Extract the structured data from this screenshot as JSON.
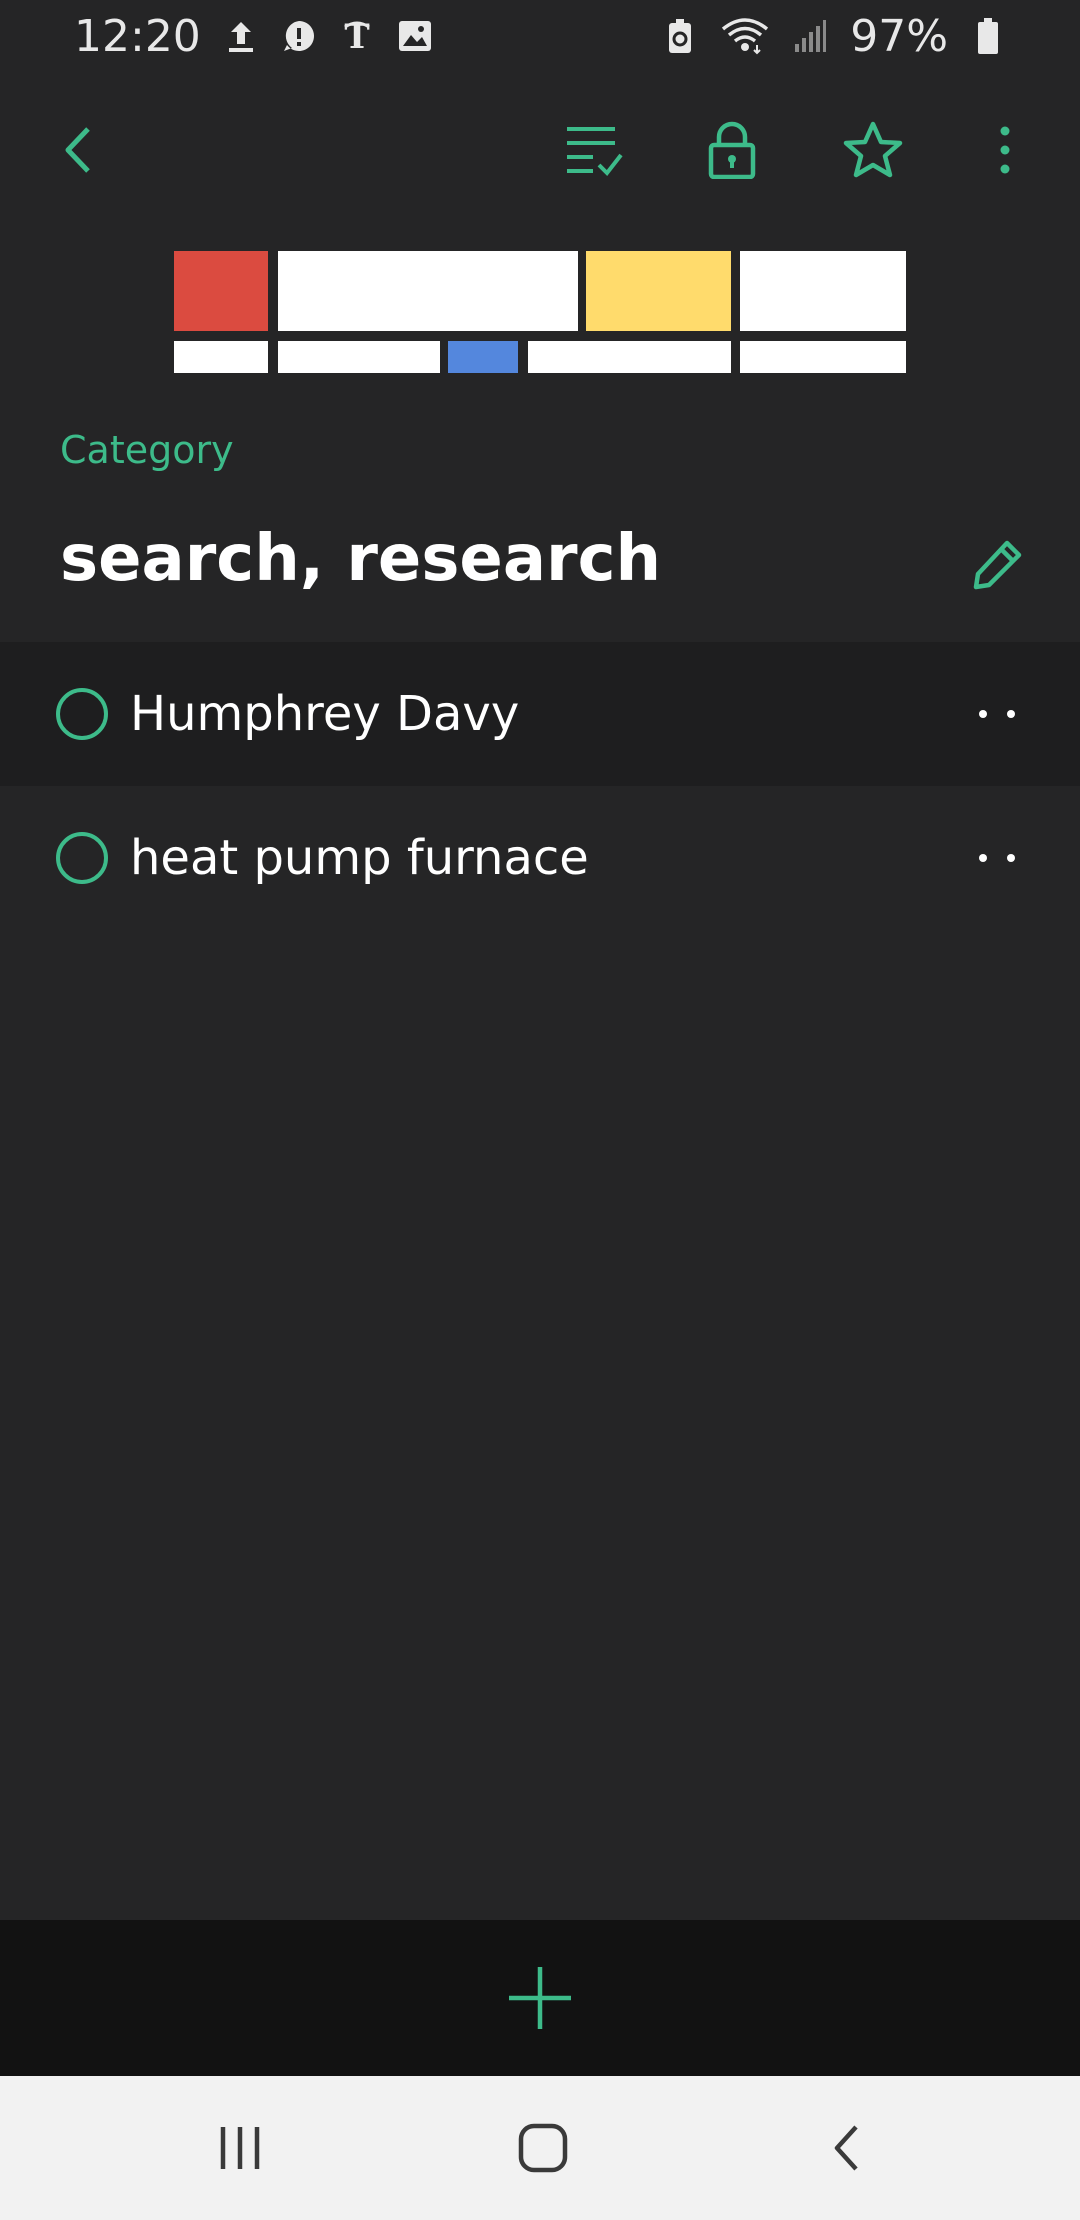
{
  "status_bar": {
    "time": "12:20",
    "left_icons": [
      "upload-icon",
      "alert-icon",
      "nyt-icon",
      "image-icon"
    ],
    "right_icons": [
      "battery-saver-icon",
      "wifi-icon",
      "signal-icon",
      "battery-icon"
    ],
    "battery_percent": "97%"
  },
  "toolbar": {
    "icons": [
      "back-icon",
      "checklist-icon",
      "lock-icon",
      "star-icon",
      "more-vert-icon"
    ]
  },
  "banner": {
    "colors": {
      "red": "#db4b40",
      "white": "#ffffff",
      "yellow": "#ffdb6c",
      "blue": "#5487dd"
    }
  },
  "category": {
    "label": "Category",
    "title": "search, research"
  },
  "items": [
    {
      "label": "Humphrey Davy",
      "highlighted": true
    },
    {
      "label": "heat pump furnace",
      "highlighted": false
    }
  ],
  "colors": {
    "accent": "#3dbb8a",
    "background": "#252526",
    "bottom_bar": "#121212",
    "nav_bar": "#f2f2f2"
  },
  "bottom_bar": {
    "icon": "add-icon"
  },
  "nav_bar": {
    "icons": [
      "recents-icon",
      "home-icon",
      "nav-back-icon"
    ]
  }
}
